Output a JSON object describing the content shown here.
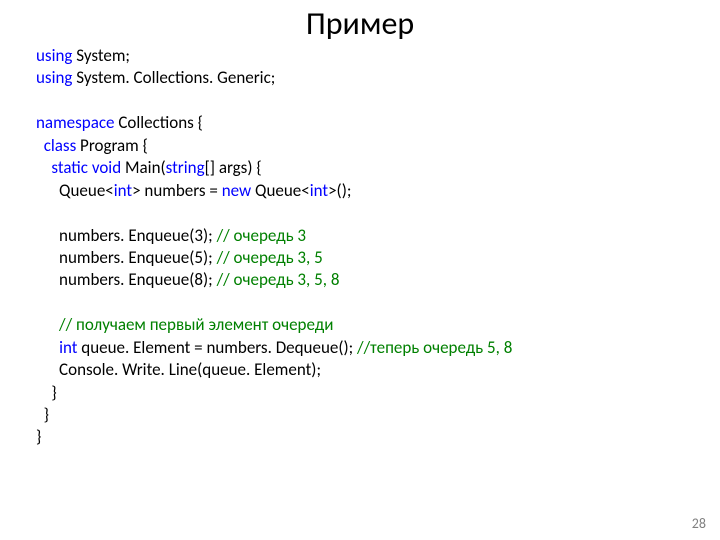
{
  "title": "Пример",
  "page_number": "28",
  "kw": {
    "using": "using",
    "namespace": "namespace",
    "class": "class",
    "static": "static",
    "void": "void",
    "string": "string",
    "int": "int",
    "new": "new"
  },
  "txt": {
    "l1_rest": " System;",
    "l2_rest": " System. Collections. Generic;",
    "l4_rest": " Collections {",
    "l5_rest": " Program {",
    "l6_rest": " Main(",
    "l6_args": "[] args) {",
    "l7a": "      Queue<",
    "l7b": "> numbers = ",
    "l7c": " Queue<",
    "l7d": ">();",
    "l9": "      numbers. Enqueue(3); ",
    "l10": "      numbers. Enqueue(5); ",
    "l11": "      numbers. Enqueue(8); ",
    "l14a": "      ",
    "l14b": " queue. Element = numbers. Dequeue(); ",
    "l15": "      Console. Write. Line(queue. Element);",
    "l16": "    }",
    "l17": "  }",
    "l18": "}"
  },
  "cm": {
    "c9": "// очередь 3",
    "c10": "// очередь 3, 5",
    "c11": "// очередь 3, 5, 8",
    "c13": "      // получаем первый элемент очереди",
    "c14": "//теперь очередь 5, 8"
  },
  "sp": {
    "s1": " ",
    "ind2": "  ",
    "ind4": "    "
  }
}
